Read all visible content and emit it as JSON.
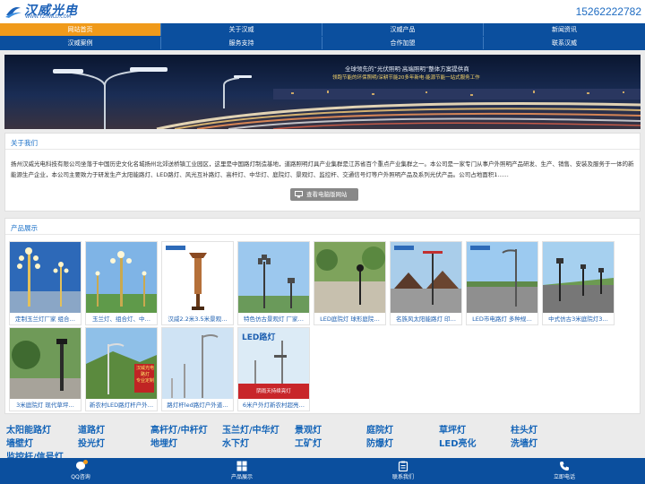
{
  "brand": {
    "name_cn": "汉威光电",
    "name_en": "WWW.YZHWLD.COM",
    "phone": "15262222782"
  },
  "nav": {
    "items": [
      {
        "label": "网站首页",
        "active": true
      },
      {
        "label": "关于汉威",
        "active": false
      },
      {
        "label": "汉威产品",
        "active": false
      },
      {
        "label": "新闻资讯",
        "active": false
      },
      {
        "label": "汉威案例",
        "active": false
      },
      {
        "label": "服务支持",
        "active": false
      },
      {
        "label": "合作加盟",
        "active": false
      },
      {
        "label": "联系汉威",
        "active": false
      }
    ]
  },
  "banner": {
    "line1": "全球领先的“光伏照明·高端照明”整体方案提供商",
    "line2": "领跑节能的环保照明/深耕节能20多年新电·能源节能一站式服务工作"
  },
  "about": {
    "title": "关于我们",
    "text": "扬州汉威光电科技有限公司坐落于中国历史文化名城扬州北郊送桥镇工业园区，这里是中国路灯制造基地，道路照明灯具产业集群是江苏省百个重点产业集群之一。本公司是一家专门从事户外照明产品研发、生产、销售、安装及服务于一体的新能源生产企业，本公司主要致力于研发生产太阳能路灯、LED路灯、风光互补路灯、高杆灯、中华灯、庭院灯、景观灯、监控杆、交通信号灯等户外照明产品及系列光伏产品。公司占地面积1......",
    "pc_button": "查看电脑版网站"
  },
  "products": {
    "title": "产品展示",
    "items": [
      {
        "caption": "定制玉兰灯厂家 组合…"
      },
      {
        "caption": "玉兰灯、组合灯、中…"
      },
      {
        "caption": "汉威2.2米3.5米景观…"
      },
      {
        "caption": "特色仿古景观灯 厂家…"
      },
      {
        "caption": "LED庭院灯 球形庭院…"
      },
      {
        "caption": "名族风太阳能路灯 印…"
      },
      {
        "caption": "LED市电路灯 多种规…"
      },
      {
        "caption": "中式仿古3米庭院灯3…"
      },
      {
        "caption": "3米庭院灯 现代草坪…"
      },
      {
        "caption": "新农村LED路灯杆户外…"
      },
      {
        "caption": "路灯杆led路灯户外道…"
      },
      {
        "caption": "6米户外灯新农村超亮…"
      }
    ],
    "poster_lines": [
      "LED路灯",
      "阴雨天持续亮灯"
    ],
    "sign_lines": [
      "汉威光电",
      "路灯",
      "专业定制"
    ]
  },
  "categories": {
    "items": [
      "太阳能路灯",
      "道路灯",
      "高杆灯/中杆灯",
      "玉兰灯/中华灯",
      "景观灯",
      "庭院灯",
      "草坪灯",
      "柱头灯",
      "墙壁灯",
      "投光灯",
      "地埋灯",
      "水下灯",
      "工矿灯",
      "防爆灯",
      "LED亮化",
      "洗墙灯",
      "监控杆/信号灯"
    ]
  },
  "bottombar": {
    "items": [
      {
        "label": "QQ咨询",
        "icon": "chat-bubble-icon"
      },
      {
        "label": "产品展示",
        "icon": "grid-icon"
      },
      {
        "label": "联系我们",
        "icon": "clipboard-icon"
      },
      {
        "label": "立即电话",
        "icon": "phone-icon"
      }
    ]
  },
  "colors": {
    "nav_bg": "#0b4f9e",
    "nav_active": "#f09a1a",
    "link_blue": "#1565b8"
  }
}
